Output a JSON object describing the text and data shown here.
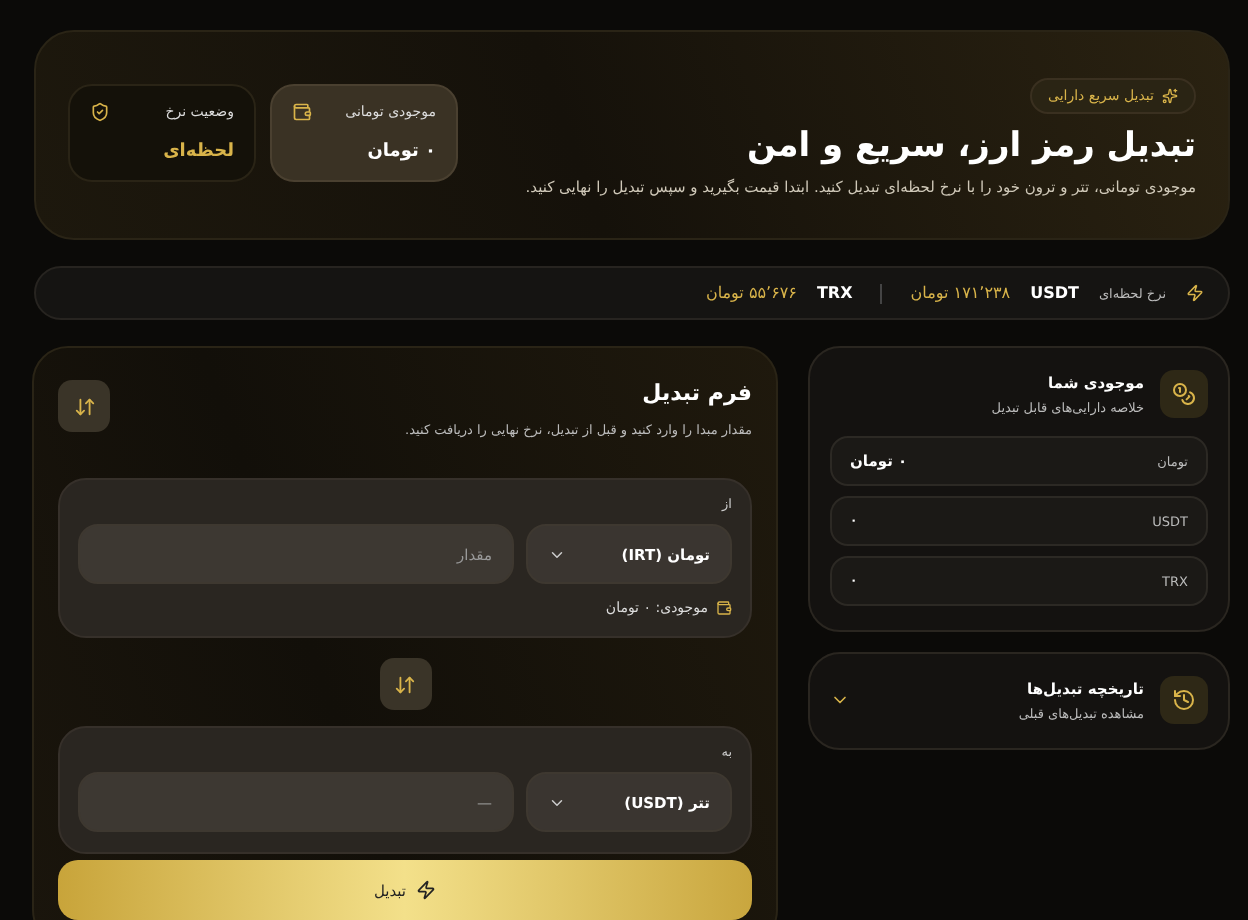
{
  "header": {
    "badge": "تبدیل سریع دارایی",
    "title": "تبدیل رمز ارز، سریع و امن",
    "description": "موجودی تومانی، تتر و ترون خود را با نرخ لحظه‌ای تبدیل کنید. ابتدا قیمت بگیرید و سپس تبدیل را نهایی کنید.",
    "stats": [
      {
        "kind": "balance",
        "label": "موجودی تومانی",
        "value": "۰ تومان"
      },
      {
        "kind": "status",
        "label": "وضعیت نرخ",
        "value": "لحظه‌ای"
      }
    ]
  },
  "rates": {
    "label": "نرخ لحظه‌ای",
    "items": [
      {
        "symbol": "USDT",
        "price": "۱۷۱٬۲۳۸ تومان"
      },
      {
        "symbol": "TRX",
        "price": "۵۵٬۶۷۶ تومان"
      }
    ]
  },
  "balances": {
    "title": "موجودی شما",
    "subtitle": "خلاصه دارایی‌های قابل تبدیل",
    "items": [
      {
        "name": "تومان",
        "amount": "۰ تومان",
        "primary": true
      },
      {
        "name": "USDT",
        "amount": "۰",
        "primary": false
      },
      {
        "name": "TRX",
        "amount": "۰",
        "primary": false
      }
    ]
  },
  "history": {
    "title": "تاریخچه تبدیل‌ها",
    "subtitle": "مشاهده تبدیل‌های قبلی",
    "expanded": false
  },
  "form": {
    "title": "فرم تبدیل",
    "subtitle": "مقدار مبدا را وارد کنید و قبل از تبدیل، نرخ نهایی را دریافت کنید.",
    "from": {
      "label": "از",
      "currency": "تومان (IRT)",
      "placeholder": "مقدار",
      "balance": "موجودی: ۰ تومان"
    },
    "to": {
      "label": "به",
      "currency": "تتر (USDT)",
      "placeholder": "—"
    },
    "submit": "تبدیل"
  }
}
